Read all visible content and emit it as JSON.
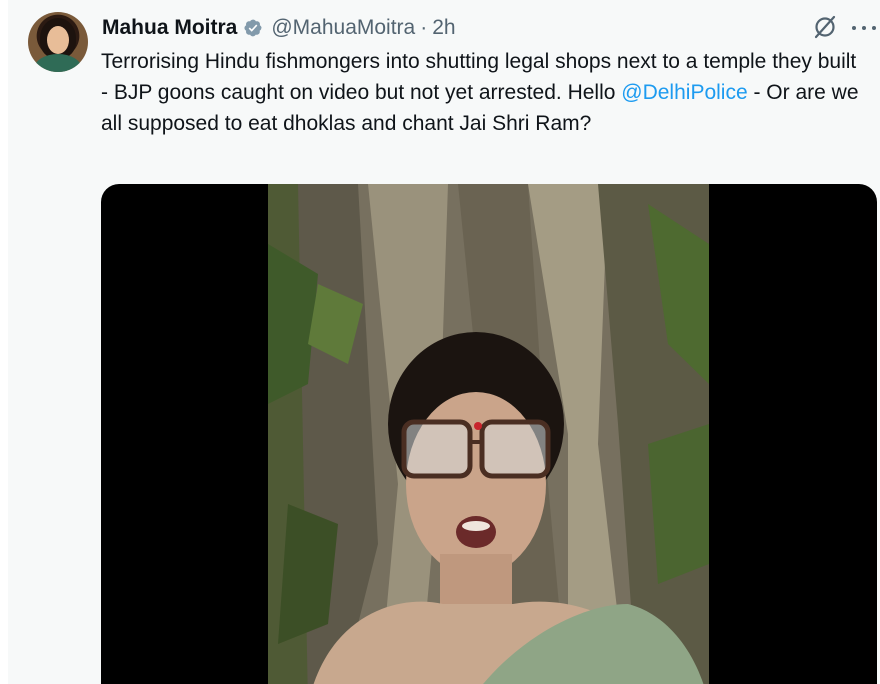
{
  "author": {
    "name": "Mahua Moitra",
    "handle": "@MahuaMoitra",
    "separator": "·",
    "time": "2h"
  },
  "tweet": {
    "text_part1": "Terrorising Hindu fishmongers into shutting legal shops next to a temple they built - BJP goons caught on video but not yet arrested. Hello ",
    "mention": "@DelhiPolice",
    "text_part2": " - Or are we all supposed to eat dhoklas and chant Jai Shri Ram?"
  },
  "icons": {
    "verified": "verified-badge-icon",
    "grok": "grok-icon",
    "more": "more-icon",
    "avatar": "avatar"
  },
  "colors": {
    "mention": "#1d9bf0",
    "verified_badge": "#829aab",
    "secondary_text": "#536471",
    "media_background": "#000000"
  },
  "media": {
    "type": "video"
  }
}
